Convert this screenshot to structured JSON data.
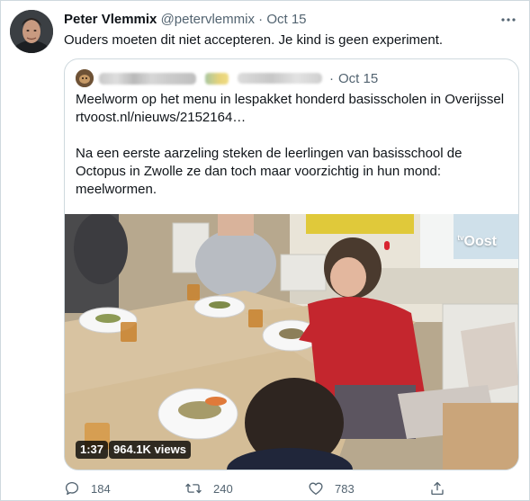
{
  "tweet": {
    "author_name": "Peter Vlemmix",
    "author_handle": "@petervlemmix",
    "separator": "·",
    "date": "Oct 15",
    "text": "Ouders moeten dit niet accepteren. Je kind is geen experiment."
  },
  "quoted_tweet": {
    "separator": "·",
    "date": "Oct 15",
    "headline": "Meelworm op het menu in lespakket honderd basisscholen in Overijssel",
    "link": "rtvoost.nl/nieuws/2152164…",
    "body": "Na een eerste aarzeling steken de leerlingen van basisschool de Octopus in Zwolle ze dan toch maar voorzichtig in hun mond: meelwormen.",
    "video": {
      "duration": "1:37",
      "views": "964.1K views",
      "watermark": "Oost"
    }
  },
  "actions": {
    "reply_count": "184",
    "retweet_count": "240",
    "like_count": "783"
  },
  "icons": {
    "more": "more-icon",
    "reply": "reply-icon",
    "retweet": "retweet-icon",
    "like": "heart-icon",
    "share": "share-icon"
  },
  "colors": {
    "text": "#0f1419",
    "muted": "#536471",
    "border": "#cfd9de"
  }
}
